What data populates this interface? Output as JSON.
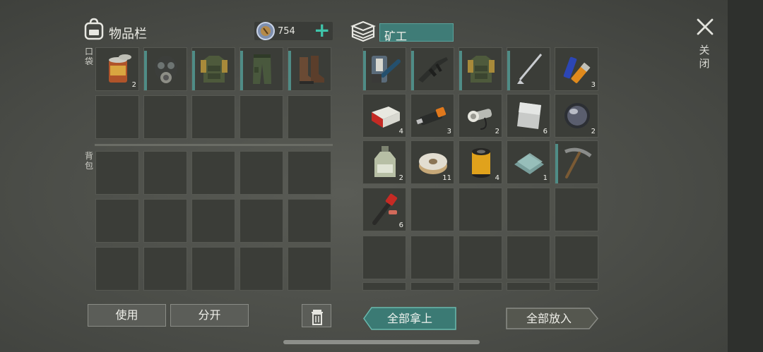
{
  "inventory": {
    "title": "物品栏",
    "coins": "754",
    "add_symbol": "+",
    "pocket_label": "口袋",
    "backpack_label": "背包",
    "pocket_items": [
      {
        "icon": "canned-food-icon",
        "count": "2"
      },
      {
        "icon": "gas-mask-icon",
        "count": ""
      },
      {
        "icon": "armor-vest-icon",
        "count": ""
      },
      {
        "icon": "military-pants-icon",
        "count": ""
      },
      {
        "icon": "boots-icon",
        "count": ""
      }
    ]
  },
  "container": {
    "title": "矿工",
    "items": [
      {
        "icon": "meat-tenderizer-icon",
        "count": ""
      },
      {
        "icon": "assault-rifle-icon",
        "count": ""
      },
      {
        "icon": "armor-vest-icon",
        "count": ""
      },
      {
        "icon": "golf-club-icon",
        "count": ""
      },
      {
        "icon": "batteries-icon",
        "count": "3"
      },
      {
        "icon": "cigarette-pack-icon",
        "count": "4"
      },
      {
        "icon": "usb-drive-icon",
        "count": "3"
      },
      {
        "icon": "flashlight-icon",
        "count": "2"
      },
      {
        "icon": "metal-plate-icon",
        "count": "6"
      },
      {
        "icon": "lens-icon",
        "count": "2"
      },
      {
        "icon": "chemical-bottle-icon",
        "count": "2"
      },
      {
        "icon": "wire-spool-icon",
        "count": "11"
      },
      {
        "icon": "filter-cartridge-icon",
        "count": "4"
      },
      {
        "icon": "glass-sheets-icon",
        "count": "1"
      },
      {
        "icon": "pickaxe-icon",
        "count": ""
      },
      {
        "icon": "flare-icon",
        "count": "6"
      }
    ]
  },
  "actions": {
    "use": "使用",
    "split": "分开",
    "take_all": "全部拿上",
    "put_all": "全部放入",
    "close": "关闭"
  }
}
